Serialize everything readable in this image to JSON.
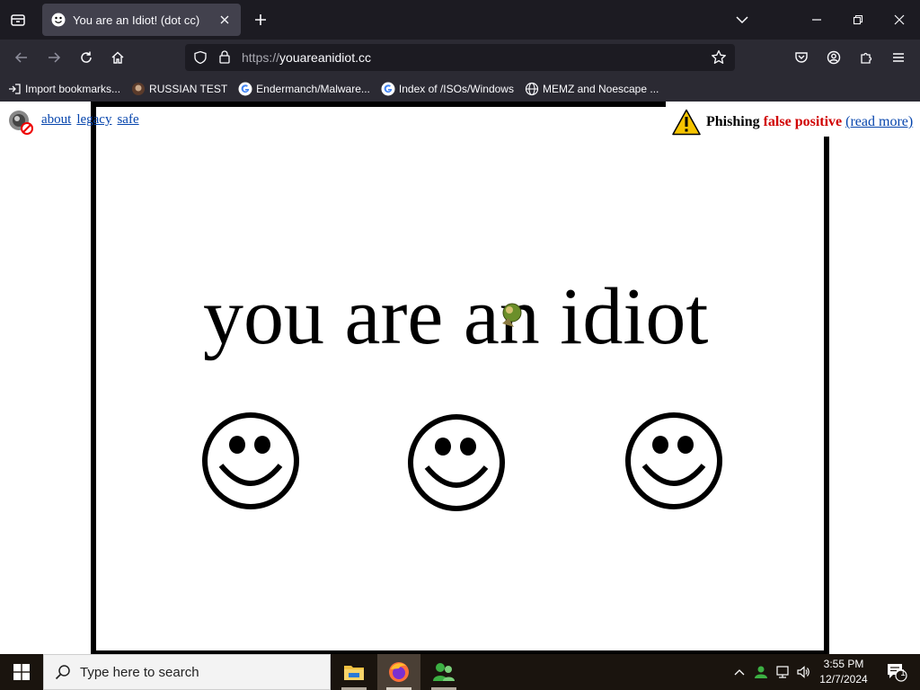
{
  "browser": {
    "tab": {
      "title": "You are an Idiot! (dot cc)"
    },
    "url": {
      "protocol": "https://",
      "host": "youareanidiot.cc"
    },
    "bookmarks": [
      {
        "label": "Import bookmarks...",
        "icon": "import-icon"
      },
      {
        "label": "RUSSIAN TEST",
        "icon": "site-favicon"
      },
      {
        "label": "Endermanch/Malware...",
        "icon": "google-icon"
      },
      {
        "label": "Index of /ISOs/Windows",
        "icon": "google-icon"
      },
      {
        "label": "MEMZ and Noescape ...",
        "icon": "globe-icon"
      }
    ]
  },
  "page": {
    "links": [
      "about",
      "legacy",
      "safe"
    ],
    "phishing": {
      "prefix": "Phishing",
      "highlight": "false positive",
      "link": "(read more)"
    },
    "headline": "you are an idiot"
  },
  "taskbar": {
    "search_placeholder": "Type here to search",
    "time": "3:55 PM",
    "date": "12/7/2024",
    "notification_count": "1"
  },
  "colors": {
    "tab_bar": "#1c1b22",
    "toolbar": "#2b2a33",
    "link": "#0645ad",
    "warning_red": "#d00000"
  }
}
